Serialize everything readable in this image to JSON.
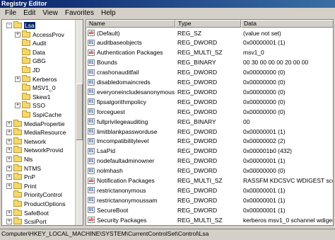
{
  "window": {
    "title": "Registry Editor"
  },
  "menu": [
    "File",
    "Edit",
    "View",
    "Favorites",
    "Help"
  ],
  "tree": [
    {
      "label": "Lsa",
      "expander": "-",
      "indent": 0,
      "selected": true
    },
    {
      "label": "AccessProv",
      "expander": "+",
      "indent": 1
    },
    {
      "label": "Audit",
      "expander": "",
      "indent": 1
    },
    {
      "label": "Data",
      "expander": "",
      "indent": 1
    },
    {
      "label": "GBG",
      "expander": "",
      "indent": 1
    },
    {
      "label": "JD",
      "expander": "",
      "indent": 1
    },
    {
      "label": "Kerberos",
      "expander": "+",
      "indent": 1
    },
    {
      "label": "MSV1_0",
      "expander": "",
      "indent": 1
    },
    {
      "label": "Skew1",
      "expander": "",
      "indent": 1
    },
    {
      "label": "SSO",
      "expander": "+",
      "indent": 1
    },
    {
      "label": "SspiCache",
      "expander": "",
      "indent": 1
    },
    {
      "label": "MediaPropertie",
      "expander": "+",
      "indent": 0
    },
    {
      "label": "MediaResource",
      "expander": "+",
      "indent": 0
    },
    {
      "label": "Network",
      "expander": "+",
      "indent": 0
    },
    {
      "label": "NetworkProvid",
      "expander": "+",
      "indent": 0
    },
    {
      "label": "Nls",
      "expander": "+",
      "indent": 0
    },
    {
      "label": "NTMS",
      "expander": "+",
      "indent": 0
    },
    {
      "label": "PnP",
      "expander": "+",
      "indent": 0
    },
    {
      "label": "Print",
      "expander": "+",
      "indent": 0
    },
    {
      "label": "PriorityControl",
      "expander": "",
      "indent": 0
    },
    {
      "label": "ProductOptions",
      "expander": "",
      "indent": 0
    },
    {
      "label": "SafeBoot",
      "expander": "+",
      "indent": 0
    },
    {
      "label": "ScsiPort",
      "expander": "+",
      "indent": 0
    }
  ],
  "columns": {
    "name": "Name",
    "type": "Type",
    "data": "Data"
  },
  "values": [
    {
      "icon": "ab",
      "name": "(Default)",
      "type": "REG_SZ",
      "data": "(value not set)"
    },
    {
      "icon": "bin",
      "name": "auditbaseobjects",
      "type": "REG_DWORD",
      "data": "0x00000001 (1)"
    },
    {
      "icon": "ab",
      "name": "Authentication Packages",
      "type": "REG_MULTI_SZ",
      "data": "msv1_0"
    },
    {
      "icon": "bin",
      "name": "Bounds",
      "type": "REG_BINARY",
      "data": "00 30 00 00 00 20 00 00"
    },
    {
      "icon": "bin",
      "name": "crashonauditfail",
      "type": "REG_DWORD",
      "data": "0x00000000 (0)"
    },
    {
      "icon": "bin",
      "name": "disabledomaincreds",
      "type": "REG_DWORD",
      "data": "0x00000000 (0)"
    },
    {
      "icon": "bin",
      "name": "everyoneincludesanonymous",
      "type": "REG_DWORD",
      "data": "0x00000000 (0)"
    },
    {
      "icon": "bin",
      "name": "fipsalgorithmpolicy",
      "type": "REG_DWORD",
      "data": "0x00000000 (0)"
    },
    {
      "icon": "bin",
      "name": "forceguest",
      "type": "REG_DWORD",
      "data": "0x00000000 (0)"
    },
    {
      "icon": "bin",
      "name": "fullprivilegeauditing",
      "type": "REG_BINARY",
      "data": "00"
    },
    {
      "icon": "bin",
      "name": "limitblankpassworduse",
      "type": "REG_DWORD",
      "data": "0x00000001 (1)"
    },
    {
      "icon": "bin",
      "name": "lmcompatibilitylevel",
      "type": "REG_DWORD",
      "data": "0x00000002 (2)"
    },
    {
      "icon": "bin",
      "name": "LsaPid",
      "type": "REG_DWORD",
      "data": "0x000001b0 (432)"
    },
    {
      "icon": "bin",
      "name": "nodefaultadminowner",
      "type": "REG_DWORD",
      "data": "0x00000001 (1)"
    },
    {
      "icon": "bin",
      "name": "nolmhash",
      "type": "REG_DWORD",
      "data": "0x00000000 (0)"
    },
    {
      "icon": "ab",
      "name": "Notification Packages",
      "type": "REG_MULTI_SZ",
      "data": "RASSFM KDCSVC WDIGEST scecli"
    },
    {
      "icon": "bin",
      "name": "restrictanonymous",
      "type": "REG_DWORD",
      "data": "0x00000001 (1)"
    },
    {
      "icon": "bin",
      "name": "restrictanonymoussam",
      "type": "REG_DWORD",
      "data": "0x00000001 (1)"
    },
    {
      "icon": "bin",
      "name": "SecureBoot",
      "type": "REG_DWORD",
      "data": "0x00000001 (1)"
    },
    {
      "icon": "ab",
      "name": "Security Packages",
      "type": "REG_MULTI_SZ",
      "data": "kerberos msv1_0 schannel wdigest"
    }
  ],
  "status": {
    "path": "Computer\\HKEY_LOCAL_MACHINE\\SYSTEM\\CurrentControlSet\\Control\\Lsa"
  }
}
